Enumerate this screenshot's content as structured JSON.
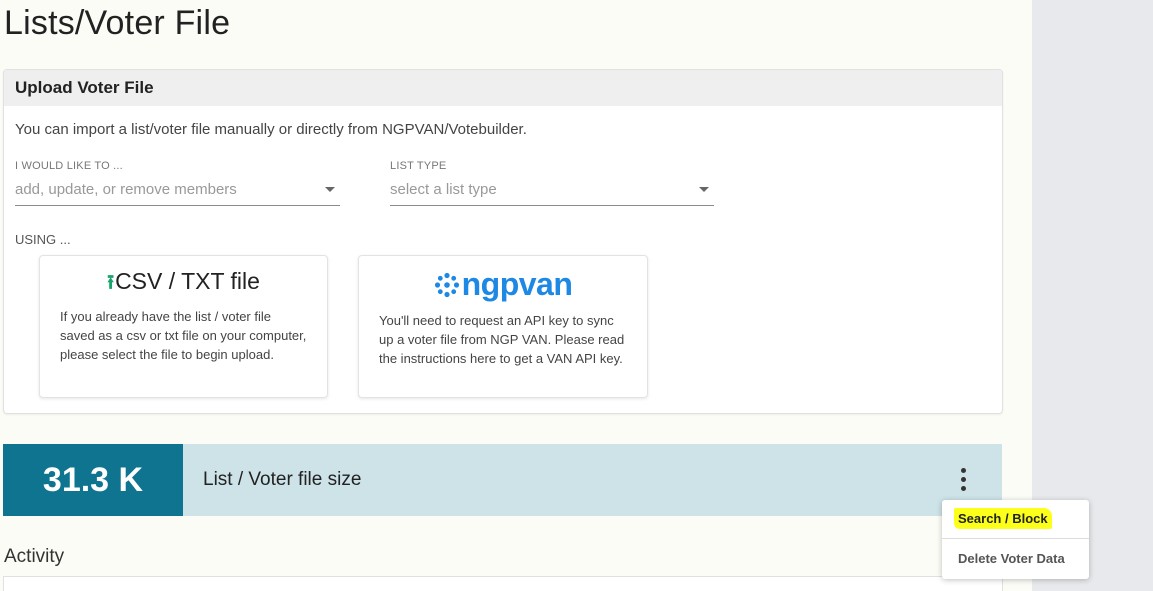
{
  "page": {
    "title": "Lists/Voter File"
  },
  "upload_card": {
    "header": "Upload Voter File",
    "intro": "You can import a list/voter file manually or directly from NGPVAN/Votebuilder.",
    "action_field": {
      "label": "I WOULD LIKE TO ...",
      "placeholder": "add, update, or remove members"
    },
    "list_type_field": {
      "label": "LIST TYPE",
      "placeholder": "select a list type"
    },
    "using_label": "USING ...",
    "csv_option": {
      "title": "CSV / TXT file",
      "icon": "upload-icon",
      "description": "If you already have the list / voter file saved as a csv or txt file on your computer, please select the file to begin upload."
    },
    "ngpvan_option": {
      "logo_text": "ngpvan",
      "description": "You'll need to request an API key to sync up a voter file from NGP VAN. Please read the instructions here to get a VAN API key."
    }
  },
  "stat": {
    "value": "31.3 K",
    "label": "List / Voter file size"
  },
  "menu": {
    "items": [
      "Search / Block",
      "Delete Voter Data"
    ]
  },
  "activity": {
    "title": "Activity"
  },
  "colors": {
    "stat_dark": "#0e7490",
    "stat_light": "#cde3e8",
    "ngpvan_blue": "#1e88e5",
    "upload_green": "#1aa36b",
    "highlight": "#fbff1a"
  }
}
